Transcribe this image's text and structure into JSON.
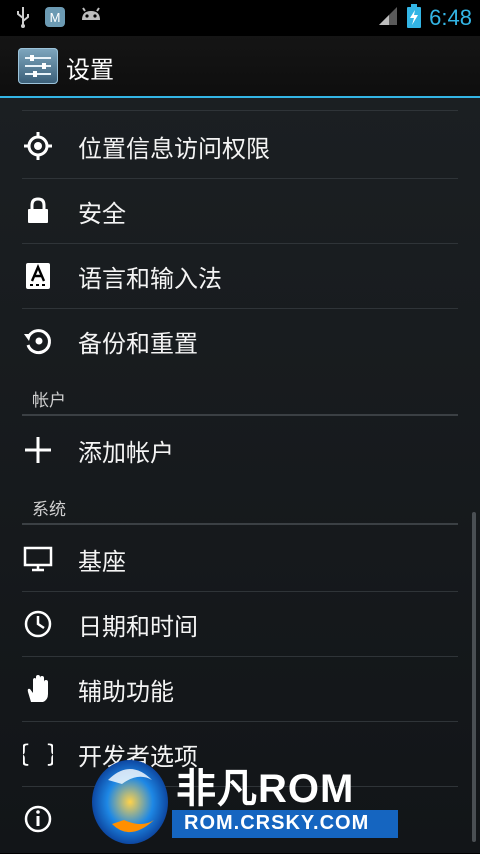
{
  "status_bar": {
    "time": "6:48"
  },
  "action_bar": {
    "title": "设置"
  },
  "list": {
    "items_personal": [
      {
        "label": "位置信息访问权限",
        "icon": "location-icon"
      },
      {
        "label": "安全",
        "icon": "lock-icon"
      },
      {
        "label": "语言和输入法",
        "icon": "keyboard-icon"
      },
      {
        "label": "备份和重置",
        "icon": "backup-icon"
      }
    ],
    "header_accounts": "帐户",
    "add_account": "添加帐户",
    "header_system": "系统",
    "items_system": [
      {
        "label": "基座",
        "icon": "dock-icon"
      },
      {
        "label": "日期和时间",
        "icon": "clock-icon"
      },
      {
        "label": "辅助功能",
        "icon": "hand-icon"
      },
      {
        "label": "开发者选项",
        "icon": "braces-icon"
      }
    ]
  },
  "watermark": {
    "brand": "非凡ROM",
    "url": "ROM.CRSKY.COM"
  }
}
